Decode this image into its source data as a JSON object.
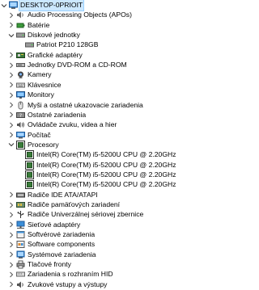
{
  "root": {
    "label": "DESKTOP-0PRIOIT"
  },
  "nodes": [
    {
      "label": "Audio Processing Objects (APOs)",
      "state": "collapsed",
      "icon": "speaker-icon",
      "level": 1
    },
    {
      "label": "Batérie",
      "state": "collapsed",
      "icon": "battery-icon",
      "level": 1
    },
    {
      "label": "Diskové jednotky",
      "state": "expanded",
      "icon": "disk-drive-icon",
      "level": 1
    },
    {
      "label": "Patriot P210 128GB",
      "state": "leaf",
      "icon": "disk-drive-icon",
      "level": 2
    },
    {
      "label": "Grafické adaptéry",
      "state": "collapsed",
      "icon": "display-adapter-icon",
      "level": 1
    },
    {
      "label": "Jednotky DVD-ROM a CD-ROM",
      "state": "collapsed",
      "icon": "dvd-drive-icon",
      "level": 1
    },
    {
      "label": "Kamery",
      "state": "collapsed",
      "icon": "camera-icon",
      "level": 1
    },
    {
      "label": "Klávesnice",
      "state": "collapsed",
      "icon": "keyboard-icon",
      "level": 1
    },
    {
      "label": "Monitory",
      "state": "collapsed",
      "icon": "monitor-icon",
      "level": 1
    },
    {
      "label": "Myši a ostatné ukazovacie zariadenia",
      "state": "collapsed",
      "icon": "mouse-icon",
      "level": 1
    },
    {
      "label": "Ostatné zariadenia",
      "state": "collapsed",
      "icon": "unknown-device-icon",
      "level": 1
    },
    {
      "label": "Ovládače zvuku, videa a hier",
      "state": "collapsed",
      "icon": "sound-video-icon",
      "level": 1
    },
    {
      "label": "Počítač",
      "state": "collapsed",
      "icon": "computer-icon",
      "level": 1
    },
    {
      "label": "Procesory",
      "state": "expanded",
      "icon": "processor-icon",
      "level": 1
    },
    {
      "label": "Intel(R) Core(TM) i5-5200U CPU @ 2.20GHz",
      "state": "leaf",
      "icon": "processor-icon",
      "level": 2
    },
    {
      "label": "Intel(R) Core(TM) i5-5200U CPU @ 2.20GHz",
      "state": "leaf",
      "icon": "processor-icon",
      "level": 2
    },
    {
      "label": "Intel(R) Core(TM) i5-5200U CPU @ 2.20GHz",
      "state": "leaf",
      "icon": "processor-icon",
      "level": 2
    },
    {
      "label": "Intel(R) Core(TM) i5-5200U CPU @ 2.20GHz",
      "state": "leaf",
      "icon": "processor-icon",
      "level": 2
    },
    {
      "label": "Radiče IDE ATA/ATAPI",
      "state": "collapsed",
      "icon": "ide-controller-icon",
      "level": 1
    },
    {
      "label": "Radiče pamäťových zariadení",
      "state": "collapsed",
      "icon": "storage-controller-icon",
      "level": 1
    },
    {
      "label": "Radiče Univerzálnej sériovej zbernice",
      "state": "collapsed",
      "icon": "usb-controller-icon",
      "level": 1
    },
    {
      "label": "Sieťové adaptéry",
      "state": "collapsed",
      "icon": "network-adapter-icon",
      "level": 1
    },
    {
      "label": "Softvérové zariadenia",
      "state": "collapsed",
      "icon": "software-device-icon",
      "level": 1
    },
    {
      "label": "Software components",
      "state": "collapsed",
      "icon": "software-component-icon",
      "level": 1
    },
    {
      "label": "Systémové zariadenia",
      "state": "collapsed",
      "icon": "system-device-icon",
      "level": 1
    },
    {
      "label": "Tlačové fronty",
      "state": "collapsed",
      "icon": "printer-icon",
      "level": 1
    },
    {
      "label": "Zariadenia s rozhraním HID",
      "state": "collapsed",
      "icon": "hid-device-icon",
      "level": 1
    },
    {
      "label": "Zvukové vstupy a výstupy",
      "state": "collapsed",
      "icon": "audio-io-icon",
      "level": 1
    }
  ]
}
